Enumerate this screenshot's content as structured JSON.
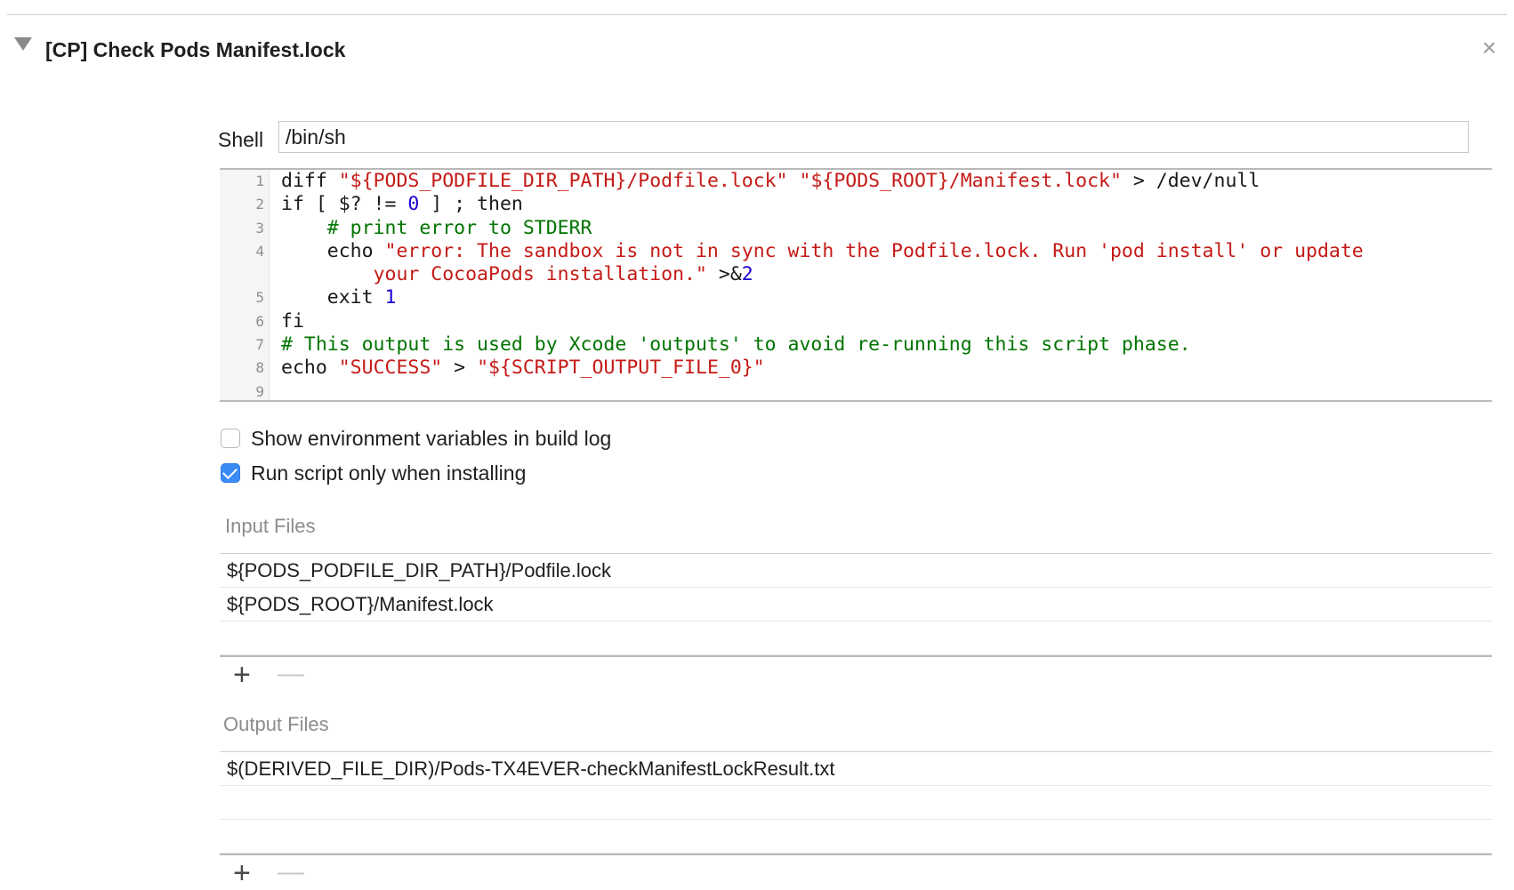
{
  "phase": {
    "title": "[CP] Check Pods Manifest.lock",
    "close_glyph": "×"
  },
  "shell": {
    "label": "Shell",
    "value": "/bin/sh"
  },
  "script": {
    "lines": [
      {
        "num": "1",
        "tokens": [
          {
            "t": "diff ",
            "k": "plain"
          },
          {
            "t": "\"${PODS_PODFILE_DIR_PATH}/Podfile.lock\"",
            "k": "str"
          },
          {
            "t": " ",
            "k": "plain"
          },
          {
            "t": "\"${PODS_ROOT}/Manifest.lock\"",
            "k": "str"
          },
          {
            "t": " > /dev/null",
            "k": "plain"
          }
        ]
      },
      {
        "num": "2",
        "tokens": [
          {
            "t": "if [ $? != ",
            "k": "plain"
          },
          {
            "t": "0",
            "k": "num"
          },
          {
            "t": " ] ; then",
            "k": "plain"
          }
        ]
      },
      {
        "num": "3",
        "tokens": [
          {
            "t": "    ",
            "k": "plain"
          },
          {
            "t": "# print error to STDERR",
            "k": "cmt"
          }
        ]
      },
      {
        "num": "4",
        "tokens": [
          {
            "t": "    echo ",
            "k": "plain"
          },
          {
            "t": "\"error: The sandbox is not in sync with the Podfile.lock. Run 'pod install' or update",
            "k": "str"
          }
        ]
      },
      {
        "num": "",
        "tokens": [
          {
            "t": "        ",
            "k": "plain"
          },
          {
            "t": "your CocoaPods installation.\"",
            "k": "str"
          },
          {
            "t": " >&",
            "k": "plain"
          },
          {
            "t": "2",
            "k": "num"
          }
        ]
      },
      {
        "num": "5",
        "tokens": [
          {
            "t": "    exit ",
            "k": "plain"
          },
          {
            "t": "1",
            "k": "num"
          }
        ]
      },
      {
        "num": "6",
        "tokens": [
          {
            "t": "fi",
            "k": "plain"
          }
        ]
      },
      {
        "num": "7",
        "tokens": [
          {
            "t": "# This output is used by Xcode 'outputs' to avoid re-running this script phase.",
            "k": "cmt"
          }
        ]
      },
      {
        "num": "8",
        "tokens": [
          {
            "t": "echo ",
            "k": "plain"
          },
          {
            "t": "\"SUCCESS\"",
            "k": "str"
          },
          {
            "t": " > ",
            "k": "plain"
          },
          {
            "t": "\"${SCRIPT_OUTPUT_FILE_0}\"",
            "k": "str"
          }
        ]
      },
      {
        "num": "9",
        "tokens": []
      }
    ]
  },
  "options": {
    "show_env": {
      "label": "Show environment variables in build log",
      "checked": false
    },
    "run_only_installing": {
      "label": "Run script only when installing",
      "checked": true
    }
  },
  "input_files": {
    "label": "Input Files",
    "items": [
      "${PODS_PODFILE_DIR_PATH}/Podfile.lock",
      "${PODS_ROOT}/Manifest.lock"
    ],
    "add_glyph": "+",
    "remove_glyph": "—"
  },
  "output_files": {
    "label": "Output Files",
    "items": [
      "$(DERIVED_FILE_DIR)/Pods-TX4EVER-checkManifestLockResult.txt"
    ],
    "add_glyph": "+",
    "remove_glyph": "—"
  },
  "colors": {
    "string": "#c41a16",
    "number": "#1c00cf",
    "comment": "#007400",
    "checkbox_accent": "#3b8bf5"
  }
}
